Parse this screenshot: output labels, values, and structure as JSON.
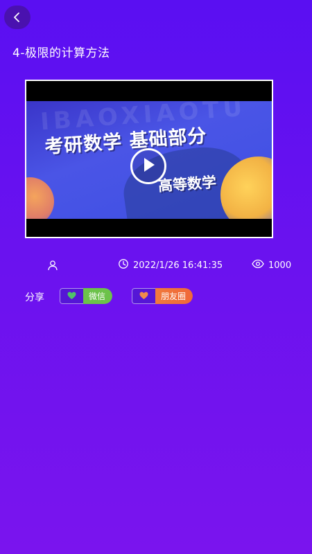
{
  "header": {
    "back_icon": "chevron-left-icon",
    "title": "4-极限的计算方法"
  },
  "video": {
    "watermark_text": "IBAOXIAOTU",
    "main_caption": "考研数学 基础部分",
    "sub_caption": "高等数学",
    "play_icon": "play-icon"
  },
  "meta": {
    "author_icon": "user-icon",
    "author_name": "",
    "time_icon": "clock-icon",
    "datetime": "2022/1/26 16:41:35",
    "views_icon": "eye-icon",
    "views": "1000"
  },
  "share": {
    "label": "分享",
    "wechat": {
      "icon": "heart-icon",
      "label": "微信",
      "heart_color": "#4fc36a",
      "bg_color": "#6cc24a"
    },
    "moments": {
      "icon": "heart-icon",
      "label": "朋友圈",
      "heart_color": "#f08a4a",
      "bg_color": "#f07a3c"
    }
  },
  "colors": {
    "bg_top": "#5a0ff2",
    "bg_bottom": "#7a14ee"
  }
}
